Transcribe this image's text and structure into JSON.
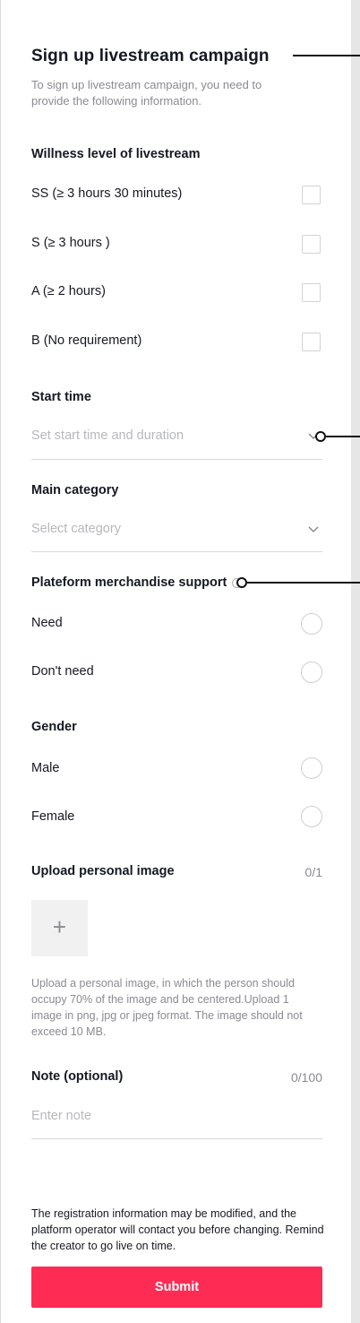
{
  "form": {
    "title": "Sign up livestream campaign",
    "description": "To sign up livestream campaign, you need to provide the following information.",
    "willness": {
      "label": "Willness level of livestream",
      "options": [
        "SS (≥ 3 hours 30 minutes)",
        "S (≥ 3 hours )",
        "A (≥ 2 hours)",
        "B (No requirement)"
      ]
    },
    "start_time": {
      "label": "Start time",
      "placeholder": "Set start time and duration"
    },
    "category": {
      "label": "Main category",
      "placeholder": "Select category"
    },
    "merch": {
      "label": "Plateform merchandise support",
      "options": [
        "Need",
        "Don't need"
      ]
    },
    "gender": {
      "label": "Gender",
      "options": [
        "Male",
        "Female"
      ]
    },
    "upload": {
      "label": "Upload personal image",
      "counter": "0/1",
      "plus": "+",
      "hint": "Upload a personal image, in which the person should occupy 70% of the image and be centered.Upload 1 image in png, jpg or jpeg format. The image should not exceed 10 MB."
    },
    "note": {
      "label": "Note (optional)",
      "counter": "0/100",
      "placeholder": "Enter note"
    },
    "footer": "The registration information may be modified, and the platform operator will contact you before changing. Remind the creator to go live on time.",
    "submit_label": "Submit"
  },
  "colors": {
    "accent": "#fe2c55",
    "text": "#161823",
    "muted": "#8a8b91",
    "placeholder": "#b7b8bc"
  },
  "icons": [
    "chevron-down-icon",
    "info-icon",
    "plus-icon"
  ]
}
